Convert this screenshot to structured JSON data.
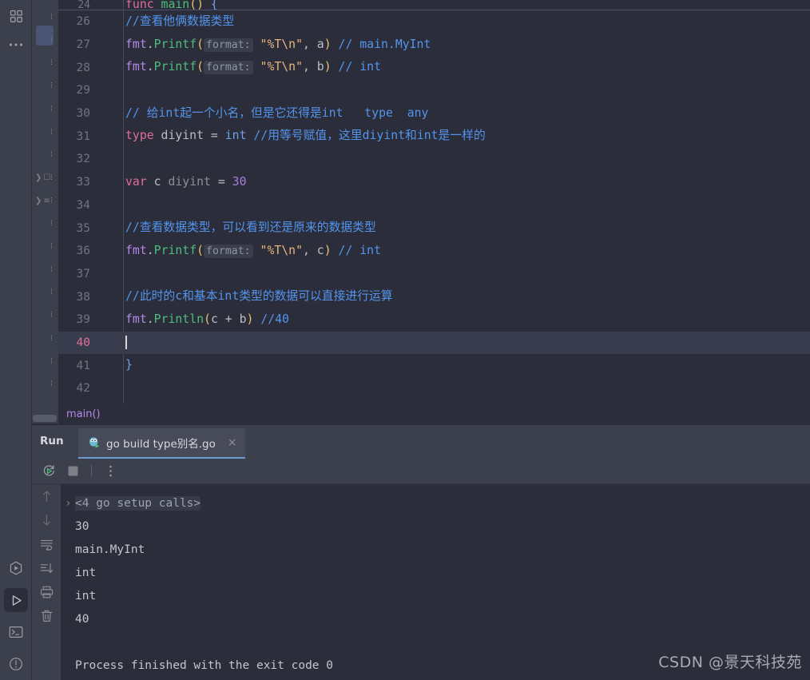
{
  "rail": {
    "top_icons": [
      {
        "name": "project-grid-icon",
        "glyph": "grid"
      },
      {
        "name": "more-options-icon",
        "glyph": "dots"
      }
    ],
    "bottom_icons": [
      {
        "name": "run-anything-icon",
        "glyph": "run-outline"
      },
      {
        "name": "run-tool-window-icon",
        "glyph": "play",
        "selected": true
      },
      {
        "name": "terminal-icon",
        "glyph": "terminal"
      },
      {
        "name": "problems-icon",
        "glyph": "warning"
      }
    ]
  },
  "project_strip": {
    "rows": [
      "",
      "",
      "",
      "",
      "",
      "",
      "",
      "",
      "",
      "expand",
      "expand"
    ]
  },
  "editor": {
    "partial_top_line": {
      "number": "24",
      "tokens": [
        {
          "t": "kw",
          "v": "func "
        },
        {
          "t": "fn",
          "v": "main"
        },
        {
          "t": "par",
          "v": "()"
        },
        {
          "t": "brace",
          "v": " {"
        }
      ]
    },
    "current_line": 40,
    "lines": [
      {
        "n": "26",
        "tokens": [
          {
            "t": "cmt",
            "v": "//查看他俩数据类型"
          }
        ]
      },
      {
        "n": "27",
        "tokens": [
          {
            "t": "pkg",
            "v": "fmt"
          },
          {
            "t": "id",
            "v": "."
          },
          {
            "t": "fn",
            "v": "Printf"
          },
          {
            "t": "par",
            "v": "("
          },
          {
            "t": "hint",
            "v": "format:"
          },
          {
            "t": "str",
            "v": "\"%T\\n\""
          },
          {
            "t": "id",
            "v": ", a"
          },
          {
            "t": "par",
            "v": ")"
          },
          {
            "t": "cmt",
            "v": " // main.MyInt"
          }
        ]
      },
      {
        "n": "28",
        "tokens": [
          {
            "t": "pkg",
            "v": "fmt"
          },
          {
            "t": "id",
            "v": "."
          },
          {
            "t": "fn",
            "v": "Printf"
          },
          {
            "t": "par",
            "v": "("
          },
          {
            "t": "hint",
            "v": "format:"
          },
          {
            "t": "str",
            "v": "\"%T\\n\""
          },
          {
            "t": "id",
            "v": ", b"
          },
          {
            "t": "par",
            "v": ")"
          },
          {
            "t": "cmt",
            "v": " // int"
          }
        ]
      },
      {
        "n": "29",
        "tokens": []
      },
      {
        "n": "30",
        "tokens": [
          {
            "t": "cmt",
            "v": "// 给int起一个小名，但是它还得是int   type  any"
          }
        ]
      },
      {
        "n": "31",
        "tokens": [
          {
            "t": "kw",
            "v": "type"
          },
          {
            "t": "id",
            "v": " diyint "
          },
          {
            "t": "id",
            "v": "= "
          },
          {
            "t": "brace",
            "v": "int"
          },
          {
            "t": "cmt",
            "v": " //用等号赋值，这里diyint和int是一样的"
          }
        ]
      },
      {
        "n": "32",
        "tokens": []
      },
      {
        "n": "33",
        "tokens": [
          {
            "t": "kw",
            "v": "var"
          },
          {
            "t": "id",
            "v": " c "
          },
          {
            "t": "type",
            "v": "diyint"
          },
          {
            "t": "id",
            "v": " = "
          },
          {
            "t": "num",
            "v": "30"
          }
        ]
      },
      {
        "n": "34",
        "tokens": []
      },
      {
        "n": "35",
        "tokens": [
          {
            "t": "cmt",
            "v": "//查看数据类型，可以看到还是原来的数据类型"
          }
        ]
      },
      {
        "n": "36",
        "tokens": [
          {
            "t": "pkg",
            "v": "fmt"
          },
          {
            "t": "id",
            "v": "."
          },
          {
            "t": "fn",
            "v": "Printf"
          },
          {
            "t": "par",
            "v": "("
          },
          {
            "t": "hint",
            "v": "format:"
          },
          {
            "t": "str",
            "v": "\"%T\\n\""
          },
          {
            "t": "id",
            "v": ", c"
          },
          {
            "t": "par",
            "v": ")"
          },
          {
            "t": "cmt",
            "v": " // int"
          }
        ]
      },
      {
        "n": "37",
        "tokens": []
      },
      {
        "n": "38",
        "tokens": [
          {
            "t": "cmt",
            "v": "//此时的c和基本int类型的数据可以直接进行运算"
          }
        ]
      },
      {
        "n": "39",
        "tokens": [
          {
            "t": "pkg",
            "v": "fmt"
          },
          {
            "t": "id",
            "v": "."
          },
          {
            "t": "fn",
            "v": "Println"
          },
          {
            "t": "par",
            "v": "("
          },
          {
            "t": "id",
            "v": "c + b"
          },
          {
            "t": "par",
            "v": ")"
          },
          {
            "t": "cmt",
            "v": " //40"
          }
        ]
      },
      {
        "n": "40",
        "tokens": [],
        "caret": true
      },
      {
        "n": "41",
        "tokens": [
          {
            "t": "brace",
            "v": "}"
          }
        ]
      },
      {
        "n": "42",
        "tokens": []
      }
    ]
  },
  "breadcrumb": {
    "text": "main()"
  },
  "run_window": {
    "title": "Run",
    "tab": {
      "label": "go build type别名.go",
      "close": "×",
      "icon": "go-gopher-run-icon"
    },
    "toolbar": [
      {
        "name": "rerun-icon",
        "glyph": "rerun"
      },
      {
        "name": "stop-icon",
        "glyph": "stop"
      },
      {
        "name": "more-actions-icon",
        "glyph": "vdots"
      }
    ],
    "console_rail": [
      {
        "name": "previous-occurrence-icon",
        "glyph": "up",
        "dim": true
      },
      {
        "name": "next-occurrence-icon",
        "glyph": "down",
        "dim": true
      },
      {
        "name": "soft-wrap-icon",
        "glyph": "wrap"
      },
      {
        "name": "scroll-to-end-icon",
        "glyph": "scroll-end"
      },
      {
        "name": "print-icon",
        "glyph": "print"
      },
      {
        "name": "clear-all-icon",
        "glyph": "trash"
      }
    ],
    "console_output": [
      {
        "type": "fold",
        "chevron": "›",
        "text": "<4 go setup calls>"
      },
      {
        "type": "text",
        "text": "30"
      },
      {
        "type": "text",
        "text": "main.MyInt"
      },
      {
        "type": "text",
        "text": "int"
      },
      {
        "type": "text",
        "text": "int"
      },
      {
        "type": "text",
        "text": "40"
      },
      {
        "type": "blank",
        "text": ""
      },
      {
        "type": "text",
        "text": "Process finished with the exit code 0"
      }
    ]
  },
  "watermark": {
    "text": "CSDN @景天科技苑"
  },
  "colors": {
    "editor_bg": "#2b2d3a",
    "panel_bg": "#3c3f4c",
    "current_line": "#393c4c",
    "accent_tab": "#6b9bd2",
    "comment": "#5394ec",
    "keyword": "#e06c9f",
    "function": "#4fbd7c",
    "string": "#e8b57c",
    "number": "#a97fe0",
    "paren": "#e9c46a",
    "breadcrumb": "#b389e8"
  }
}
